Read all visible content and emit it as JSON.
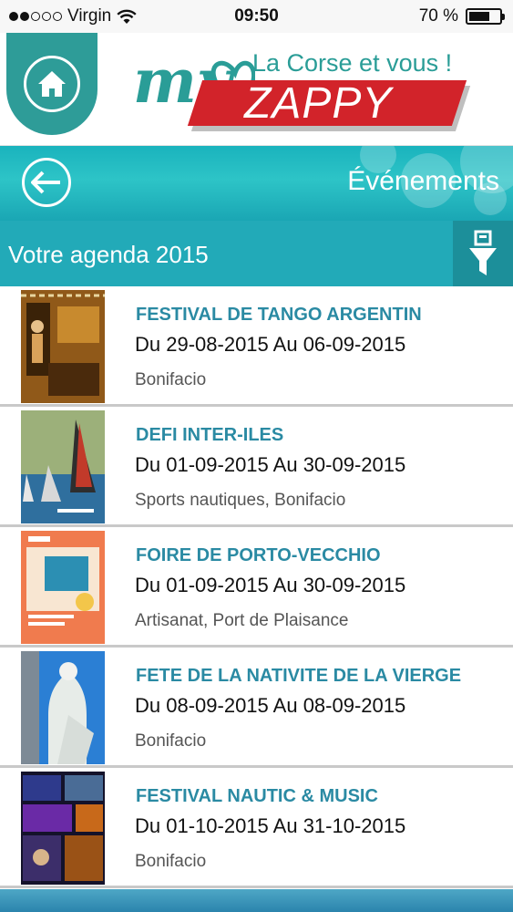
{
  "status_bar": {
    "carrier": "Virgin",
    "time": "09:50",
    "battery": "70 %",
    "battery_level": 0.7
  },
  "header": {
    "logo_my": "my",
    "logo_tagline": "La Corse et vous !",
    "logo_brand": "ZAPPY"
  },
  "banner": {
    "title": "Événements"
  },
  "agenda": {
    "title": "Votre agenda 2015"
  },
  "events": [
    {
      "title": "FESTIVAL DE TANGO ARGENTIN",
      "dates": "Du 29-08-2015 Au 06-09-2015",
      "place": "Bonifacio"
    },
    {
      "title": "DEFI INTER-ILES",
      "dates": "Du 01-09-2015 Au 30-09-2015",
      "place": "Sports nautiques, Bonifacio"
    },
    {
      "title": "FOIRE DE PORTO-VECCHIO",
      "dates": "Du 01-09-2015 Au 30-09-2015",
      "place": "Artisanat, Port de Plaisance"
    },
    {
      "title": "FETE DE LA NATIVITE DE LA VIERGE",
      "dates": "Du 08-09-2015 Au 08-09-2015",
      "place": "Bonifacio"
    },
    {
      "title": "FESTIVAL NAUTIC & MUSIC",
      "dates": "Du 01-10-2015 Au 31-10-2015",
      "place": "Bonifacio"
    }
  ],
  "colors": {
    "teal": "#2e9c98",
    "banner": "#1ab3bd",
    "agenda_bar": "#22aab8",
    "title_blue": "#2a8aa3",
    "brand_red": "#d2232a"
  },
  "icons": [
    "wifi-icon",
    "battery-icon",
    "home-icon",
    "back-arrow-icon",
    "filter-icon"
  ]
}
